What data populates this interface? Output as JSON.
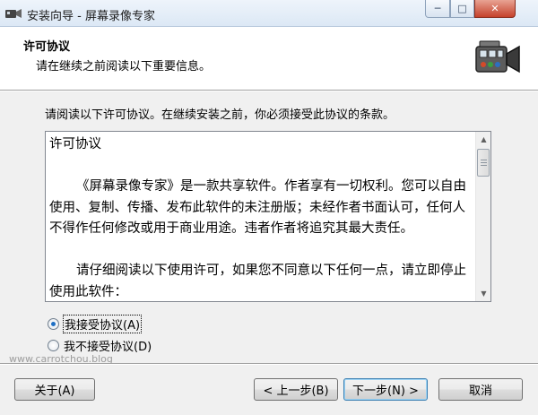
{
  "window": {
    "title": "安装向导 - 屏幕录像专家",
    "minimize_icon": "minimize-icon",
    "maximize_icon": "maximize-icon",
    "close_icon": "close-icon"
  },
  "header": {
    "title": "许可协议",
    "subtitle": "请在继续之前阅读以下重要信息。",
    "icon": "camcorder-icon"
  },
  "main": {
    "intro": "请阅读以下许可协议。在继续安装之前，你必须接受此协议的条款。",
    "license": {
      "title": "许可协议",
      "paragraph1": "《屏幕录像专家》是一款共享软件。作者享有一切权利。您可以自由使用、复制、传播、发布此软件的未注册版；未经作者书面认可，任何人不得作任何修改或用于商业用途。违者作者将追究其最大责任。",
      "paragraph2": "请仔细阅读以下使用许可，如果您不同意以下任何一点，请立即停止使用此软件："
    },
    "options": {
      "accept": "我接受协议(A)",
      "decline": "我不接受协议(D)",
      "selected": "accept"
    }
  },
  "watermark": "www.carrotchou.blog",
  "buttons": {
    "about": "关于(A)",
    "back": "< 上一步(B)",
    "next": "下一步(N) >",
    "cancel": "取消"
  }
}
